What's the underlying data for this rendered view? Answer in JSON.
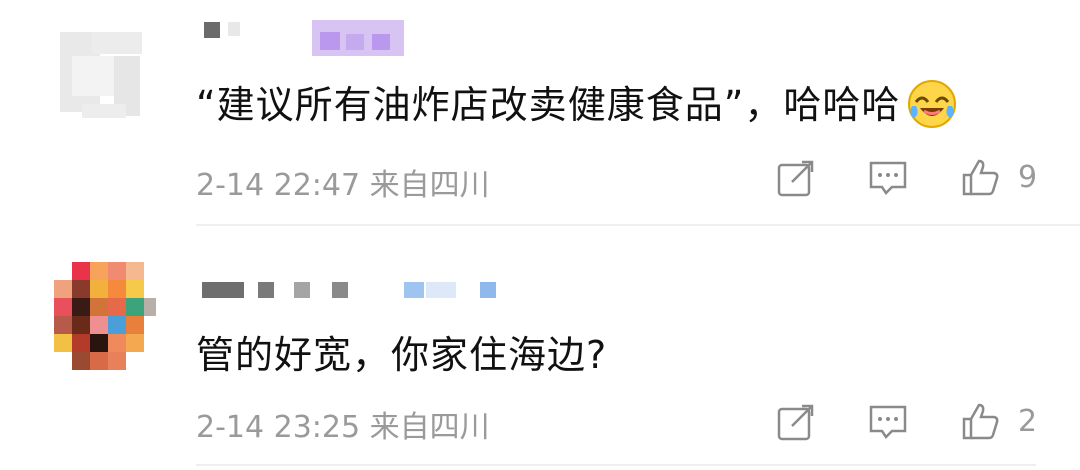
{
  "comments": [
    {
      "text": "“建议所有油炸店改卖健康食品”，哈哈哈",
      "emoji": "laughing-crying-emoji",
      "date": "2-14 22:47",
      "location": "来自四川",
      "likes": "9"
    },
    {
      "text": "管的好宽，你家住海边?",
      "date": "2-14 23:25",
      "location": "来自四川",
      "likes": "2"
    }
  ],
  "colors": {
    "meta_gray": "#9a9a9a",
    "text": "#111111",
    "divider": "#efefef"
  },
  "icons": [
    "share-icon",
    "reply-icon",
    "like-icon"
  ]
}
